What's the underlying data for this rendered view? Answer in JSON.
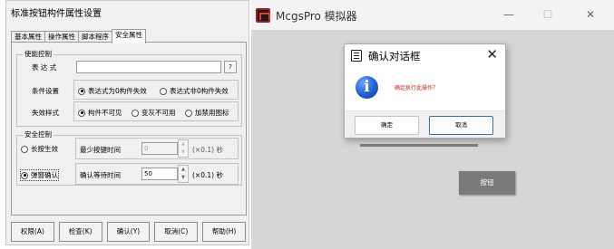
{
  "property_dialog": {
    "title": "标准按钮构件属性设置",
    "tabs": [
      "基本属性",
      "操作属性",
      "脚本程序",
      "安全属性"
    ],
    "enable_control": {
      "group_title": "使能控制",
      "expression_label": "表 达 式",
      "expression_value": "",
      "expression_button": "?",
      "condition_label": "条件设置",
      "condition_options": [
        "表达式为0构件失效",
        "表达式非0构件失效"
      ],
      "condition_selected": 0,
      "invalid_style_label": "失效样式",
      "invalid_style_options": [
        "构件不可见",
        "变灰不可用",
        "加禁用图标"
      ],
      "invalid_style_selected": 0
    },
    "safety_control": {
      "group_title": "安全控制",
      "long_press_label": "长按生效",
      "long_press_checked": false,
      "min_press_label": "最少按键时间",
      "min_press_value": "0",
      "min_press_unit": "(×0.1) 秒",
      "popup_confirm_label": "弹窗确认",
      "popup_confirm_checked": true,
      "confirm_wait_label": "确认等待时间",
      "confirm_wait_value": "50",
      "confirm_wait_unit": "(×0.1) 秒"
    },
    "buttons": [
      "权限(A)",
      "检查(K)",
      "确认(Y)",
      "取消(C)",
      "帮助(H)"
    ]
  },
  "simulator": {
    "title": "McgsPro 模拟器",
    "controls": {
      "minimize": "—",
      "maximize": "☐",
      "close": "✕"
    },
    "canvas_button_label": "按钮",
    "message_box": {
      "title": "确认对话框",
      "close_glyph": "✕",
      "icon": "info-icon",
      "message": "确定执行此操作？",
      "ok_label": "确定",
      "cancel_label": "取消"
    }
  }
}
